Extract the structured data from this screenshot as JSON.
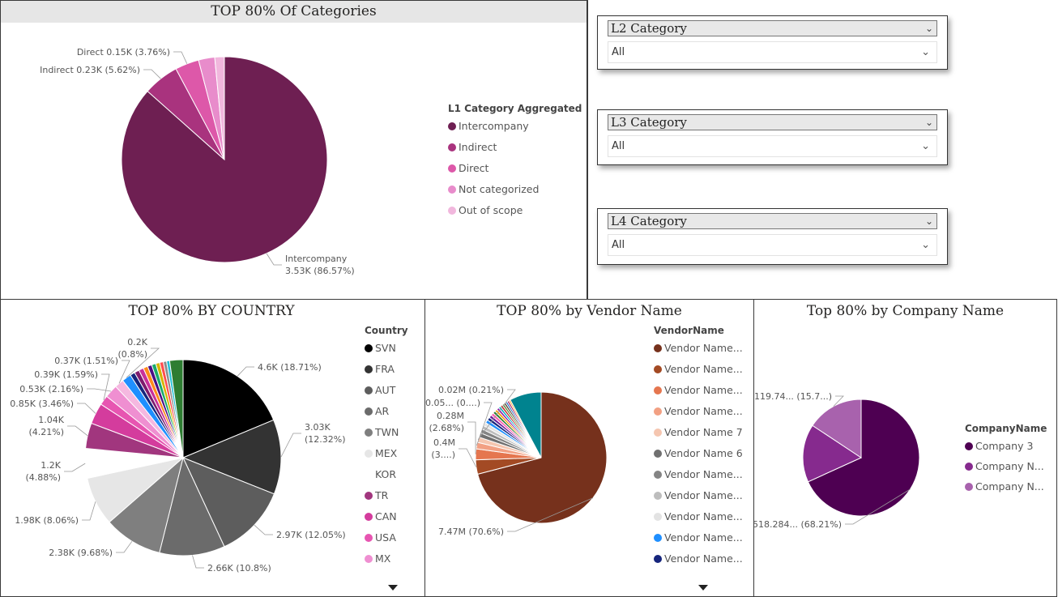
{
  "colors": {
    "categories": [
      "#6e1f52",
      "#a9337e",
      "#dd58a9",
      "#e88ccb",
      "#f1b7dd"
    ],
    "country": [
      "#000000",
      "#333333",
      "#5d5d5d",
      "#6b6b6b",
      "#7f7f7f",
      "#e6e6e6",
      "#ffffff",
      "#a1367e",
      "#d43c9d",
      "#e755b1",
      "#ef8fd1",
      "#f5b8e0",
      "#1f8fff",
      "#16257c",
      "#7e1b6e",
      "#c9309a",
      "#ff8a1d",
      "#4b0f85",
      "#1aaa6c",
      "#d4b400",
      "#ff4d4d",
      "#8c8c8c",
      "#20c0d6",
      "#2e7d32"
    ],
    "vendor": [
      "#76311c",
      "#a34a24",
      "#e5764f",
      "#f2a083",
      "#f5c6b0",
      "#707070",
      "#848484",
      "#bdbdbd",
      "#e3e3e3",
      "#1f8fff",
      "#16257c",
      "#6a1b9a",
      "#ff5fb0",
      "#2e7d32",
      "#ff9800",
      "#8e24aa",
      "#00acc1",
      "#c62828",
      "#558b2f",
      "#5d4037",
      "#1565c0",
      "#ad1457",
      "#f9a825",
      "#00838f"
    ],
    "company": [
      "#4e0052",
      "#862a8e",
      "#a862ad"
    ]
  },
  "categories_panel": {
    "title": "TOP 80% Of Categories",
    "legend_title": "L1 Category Aggregated",
    "chart_data": {
      "type": "pie",
      "legend_position": "right",
      "categories": [
        "Intercompany",
        "Indirect",
        "Direct",
        "Not categorized",
        "Out of scope"
      ],
      "values": [
        86.57,
        5.62,
        3.76,
        2.55,
        1.5
      ],
      "labels": [
        {
          "line1": "Intercompany",
          "line2": "3.53K (86.57%)"
        },
        {
          "line1": "Indirect 0.23K (5.62%)",
          "line2": ""
        },
        {
          "line1": "Direct 0.15K (3.76%)",
          "line2": ""
        },
        {
          "line1": "",
          "line2": ""
        },
        {
          "line1": "",
          "line2": ""
        }
      ]
    }
  },
  "slicers": [
    {
      "title": "L2 Category",
      "value": "All"
    },
    {
      "title": "L3 Category",
      "value": "All"
    },
    {
      "title": "L4 Category",
      "value": "All"
    }
  ],
  "country_panel": {
    "title": "TOP 80% BY COUNTRY",
    "legend_title": "Country",
    "chart_data": {
      "type": "pie",
      "legend_position": "right",
      "categories": [
        "SVN",
        "FRA",
        "AUT",
        "AR",
        "TWN",
        "MEX",
        "KOR",
        "TR",
        "CAN",
        "USA",
        "MX"
      ],
      "values": [
        18.71,
        12.32,
        12.05,
        10.8,
        9.68,
        8.06,
        4.88,
        4.21,
        3.46,
        1.59,
        2.16,
        1.51,
        1.51,
        0.8,
        0.8,
        0.8,
        0.75,
        0.7,
        0.7,
        0.65,
        0.6,
        0.55,
        0.5,
        2.2
      ],
      "labels": [
        {
          "line1": "4.6K (18.71%)",
          "line2": ""
        },
        {
          "line1": "3.03K",
          "line2": "(12.32%)"
        },
        {
          "line1": "2.97K (12.05%)",
          "line2": ""
        },
        {
          "line1": "2.66K (10.8%)",
          "line2": ""
        },
        {
          "line1": "2.38K (9.68%)",
          "line2": ""
        },
        {
          "line1": "1.98K (8.06%)",
          "line2": ""
        },
        {
          "line1": "1.2K",
          "line2": "(4.88%)"
        },
        {
          "line1": "1.04K",
          "line2": "(4.21%)"
        },
        {
          "line1": "0.85K (3.46%)",
          "line2": ""
        },
        {
          "line1": "0.39K (1.59%)",
          "line2": ""
        },
        {
          "line1": "0.53K (2.16%)",
          "line2": ""
        },
        {
          "line1": "0.37K (1.51%)",
          "line2": ""
        },
        {
          "line1": "0.2K",
          "line2": "(0.8%)"
        }
      ]
    }
  },
  "vendor_panel": {
    "title": "TOP 80% by Vendor Name",
    "legend_title": "VendorName",
    "legend_items": [
      "Vendor Name...",
      "Vendor Name...",
      "Vendor Name...",
      "Vendor Name...",
      "Vendor Name 7",
      "Vendor Name 6",
      "Vendor Name...",
      "Vendor Name...",
      "Vendor Name...",
      "Vendor Name...",
      "Vendor Name..."
    ],
    "chart_data": {
      "type": "pie",
      "legend_position": "right",
      "categories": [
        "Vendor Name...",
        "Vendor Name...",
        "Vendor Name...",
        "Vendor Name...",
        "Vendor Name 7",
        "Vendor Name 6",
        "Vendor Name...",
        "Vendor Name...",
        "Vendor Name...",
        "Vendor Name...",
        "Vendor Name..."
      ],
      "values": [
        70.6,
        3.5,
        2.68,
        1.6,
        1.3,
        1.1,
        1.0,
        0.9,
        0.85,
        0.8,
        0.75,
        0.7,
        0.7,
        0.65,
        0.6,
        0.6,
        0.55,
        0.55,
        0.5,
        0.5,
        0.45,
        0.45,
        0.4,
        7.77
      ],
      "labels": [
        {
          "line1": "7.47M (70.6%)",
          "line2": ""
        },
        {
          "line1": "0.4M",
          "line2": "(3....)"
        },
        {
          "line1": "0.28M",
          "line2": "(2.68%)"
        },
        {
          "line1": "0.05... (0....)",
          "line2": ""
        },
        {
          "line1": "0.02M (0.21%)",
          "line2": ""
        }
      ]
    }
  },
  "company_panel": {
    "title": "Top 80% by Company Name",
    "legend_title": "CompanyName",
    "legend_items": [
      "Company 3",
      "Company N...",
      "Company N..."
    ],
    "chart_data": {
      "type": "pie",
      "legend_position": "right",
      "categories": [
        "Company 3",
        "Company N...",
        "Company N..."
      ],
      "values": [
        68.21,
        16.09,
        15.7
      ],
      "labels": [
        {
          "line1": "518.284... (68.21%)",
          "line2": ""
        },
        {
          "line1": "",
          "line2": ""
        },
        {
          "line1": "119.74... (15.7...)",
          "line2": ""
        }
      ]
    }
  }
}
